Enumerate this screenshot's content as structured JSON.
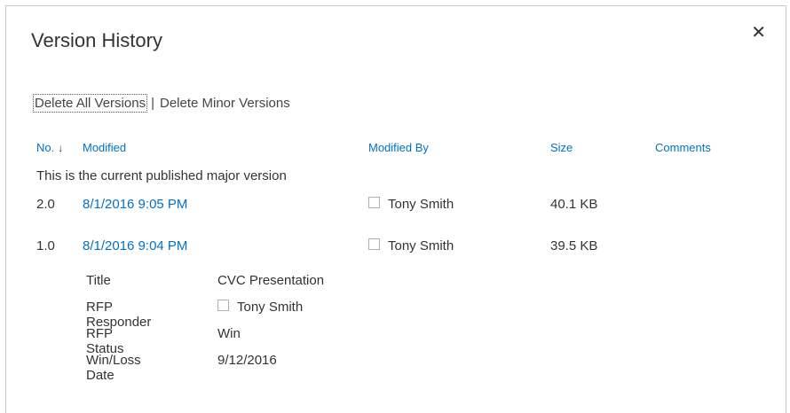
{
  "dialog": {
    "title": "Version History",
    "close_glyph": "✕"
  },
  "actions": {
    "delete_all": "Delete All Versions",
    "separator": "|",
    "delete_minor": "Delete Minor Versions"
  },
  "table": {
    "headers": {
      "no": "No.",
      "sort_arrow": "↓",
      "modified": "Modified",
      "modified_by": "Modified By",
      "size": "Size",
      "comments": "Comments"
    },
    "current_note": "This is the current published major version",
    "rows": [
      {
        "no": "2.0",
        "modified": "8/1/2016 9:05 PM",
        "modified_by": "Tony Smith",
        "size": "40.1 KB"
      },
      {
        "no": "1.0",
        "modified": "8/1/2016 9:04 PM",
        "modified_by": "Tony Smith",
        "size": "39.5 KB"
      }
    ],
    "properties": [
      {
        "name": "Title",
        "value": "CVC Presentation"
      },
      {
        "name": "RFP Responder",
        "value": "Tony Smith",
        "is_user": true
      },
      {
        "name": "RFP Status",
        "value": "Win"
      },
      {
        "name": "Win/Loss Date",
        "value": "9/12/2016"
      }
    ]
  },
  "colors": {
    "link_blue": "#0072c6",
    "text": "#333333"
  }
}
